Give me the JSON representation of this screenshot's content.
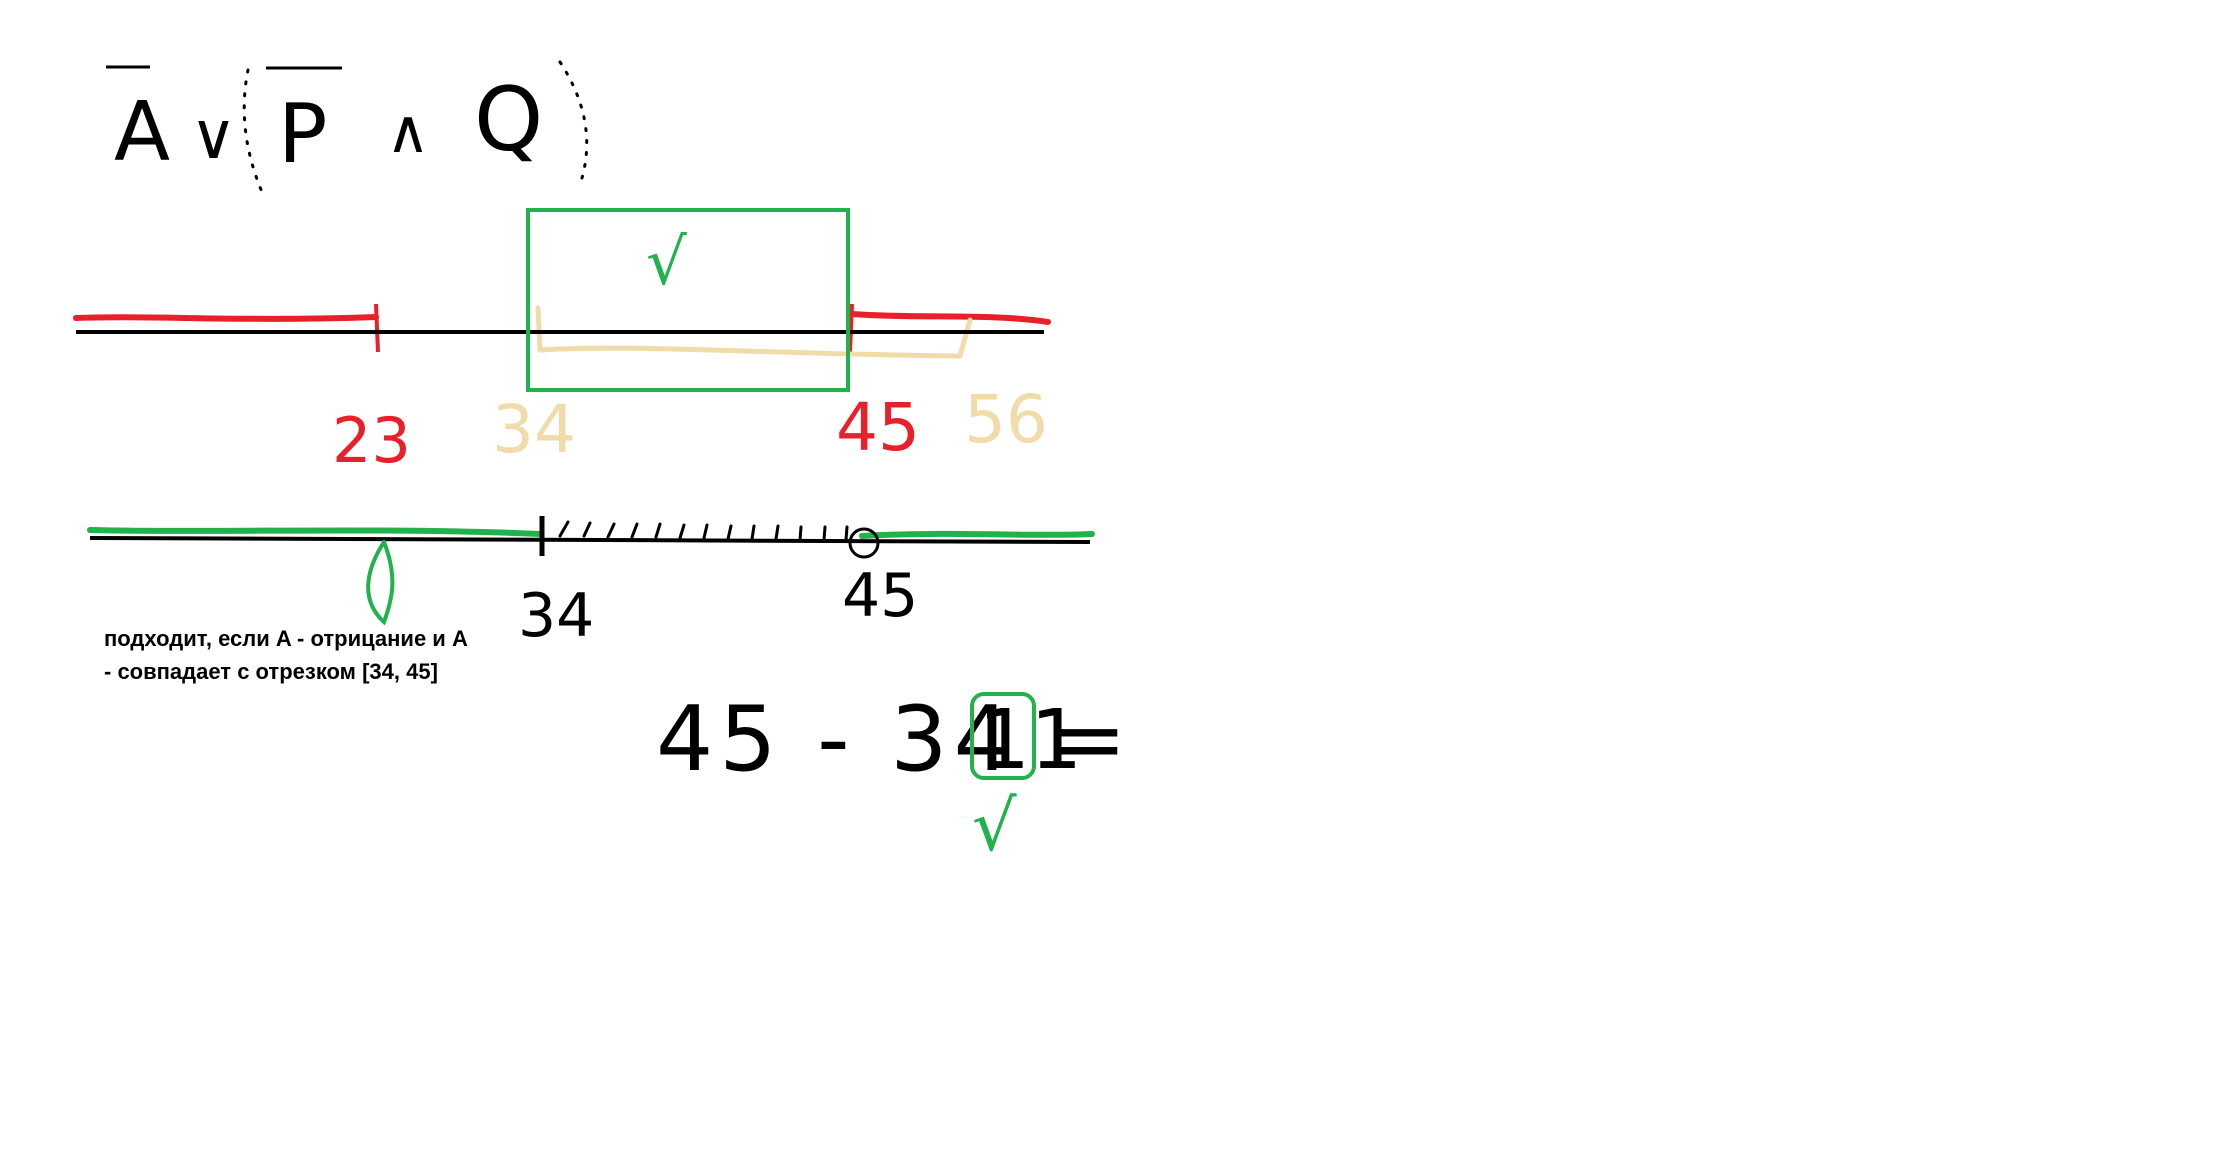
{
  "formula": {
    "a": "A",
    "or": "∨",
    "p": "P",
    "and": "∧",
    "q": "Q"
  },
  "axis1": {
    "ticks": [
      "23",
      "34",
      "45",
      "56"
    ]
  },
  "axis2": {
    "ticks": [
      "34",
      "45"
    ]
  },
  "check_mark": "√",
  "note": {
    "line1": "подходит, если A - отрицание и A",
    "line2": "- совпадает с отрезком [34, 45]"
  },
  "equation": {
    "left": "45 - 34 =",
    "result": "11"
  },
  "colors": {
    "red": "#e8202a",
    "pale_yellow": "#f1dba8",
    "green": "#22b24c",
    "black": "#000000"
  }
}
